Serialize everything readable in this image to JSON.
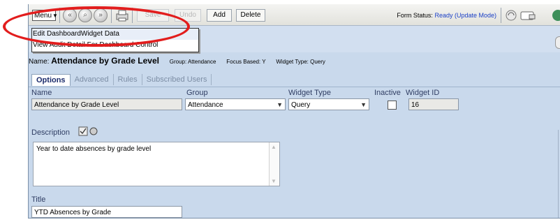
{
  "toolbar": {
    "menu_label": "Menu",
    "save_label": "Save",
    "undo_label": "Undo",
    "add_label": "Add",
    "delete_label": "Delete",
    "form_status_label": "Form Status:",
    "form_status_value": "Ready (Update Mode)"
  },
  "menu": {
    "items": [
      {
        "label": "Edit DashboardWidget Data"
      },
      {
        "label": "View Audit Detail For Dashboard Control"
      }
    ]
  },
  "header": {
    "name_label": "Name:",
    "name_value": "Attendance by Grade Level",
    "group_meta": "Group: Attendance",
    "focus_meta": "Focus Based: Y",
    "type_meta": "Widget Type: Query"
  },
  "tabs": [
    {
      "label": "Options",
      "active": true
    },
    {
      "label": "Advanced"
    },
    {
      "label": "Rules"
    },
    {
      "label": "Subscribed Users"
    }
  ],
  "form": {
    "name_label": "Name",
    "name_value": "Attendance by Grade Level",
    "group_label": "Group",
    "group_value": "Attendance",
    "widget_type_label": "Widget Type",
    "widget_type_value": "Query",
    "inactive_label": "Inactive",
    "widget_id_label": "Widget ID",
    "widget_id_value": "16",
    "description_label": "Description",
    "description_value": "Year to date absences by grade level",
    "title_label": "Title",
    "title_value": "YTD Absences by Grade"
  },
  "colors": {
    "highlight_ellipse": "#e21d1d",
    "status_value": "#1a3fc7",
    "panel": "#c9d9ec"
  }
}
